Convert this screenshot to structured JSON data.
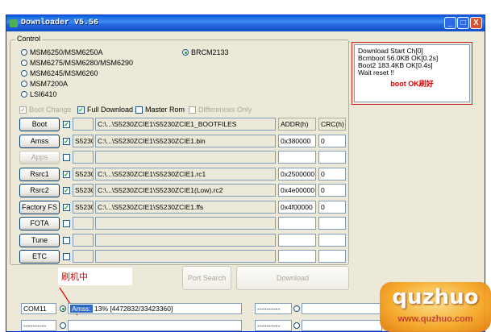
{
  "window": {
    "title": "Downloader V5.56",
    "controls": {
      "minimize": "_",
      "maximize": "□",
      "close": "X"
    }
  },
  "control_group": {
    "label": "Control",
    "chipsets": [
      {
        "label": "MSM6250/MSM6250A",
        "selected": false
      },
      {
        "label": "MSM6275/MSM6280/MSM6290",
        "selected": false
      },
      {
        "label": "MSM6245/MSM6260",
        "selected": false
      },
      {
        "label": "MSM7200A",
        "selected": false
      },
      {
        "label": "LSI6410",
        "selected": false
      },
      {
        "label": "BRCM2133",
        "selected": true
      }
    ]
  },
  "log": {
    "lines": [
      "Download Start Ch[0]",
      "Bcmboot 56.0KB OK[0.2s]",
      "Boot2 183.4KB OK[0.4s]",
      "Wait reset !!"
    ],
    "annotation": "boot OK刷好"
  },
  "options": {
    "boot_change": {
      "label": "Boot Change",
      "checked": true,
      "enabled": false
    },
    "full_download": {
      "label": "Full Download",
      "checked": true
    },
    "master_rom": {
      "label": "Master Rom",
      "checked": false
    },
    "differences_only": {
      "label": "Differences Only",
      "checked": false,
      "enabled": false
    }
  },
  "table": {
    "addr_header": "ADDR(h)",
    "crc_header": "CRC(h)",
    "rows": [
      {
        "button": "Boot",
        "enabled": true,
        "checked": true,
        "tag": "",
        "path": "C:\\...\\S5230ZCIE1\\S5230ZCIE1_BOOTFILES",
        "addr": "",
        "crc": ""
      },
      {
        "button": "Amss",
        "enabled": true,
        "checked": true,
        "tag": "S5230",
        "path": "C:\\...\\S5230ZCIE1\\S5230ZCIE1.bin",
        "addr": "0x380000",
        "crc": "0"
      },
      {
        "button": "Apps",
        "enabled": false,
        "checked": false,
        "tag": "",
        "path": "",
        "addr": "",
        "crc": ""
      },
      {
        "button": "Rsrc1",
        "enabled": true,
        "checked": true,
        "tag": "S5230",
        "path": "C:\\...\\S5230ZCIE1\\S5230ZCIE1.rc1",
        "addr": "0x2500000",
        "crc": "0"
      },
      {
        "button": "Rsrc2",
        "enabled": true,
        "checked": true,
        "tag": "S5230",
        "path": "C:\\...\\S5230ZCIE1\\S5230ZCIE1(Low).rc2",
        "addr": "0x4e00000",
        "crc": "0"
      },
      {
        "button": "Factory FS",
        "enabled": true,
        "checked": true,
        "tag": "S5230",
        "path": "C:\\...\\S5230ZCIE1\\S5230ZCIE1.ffs",
        "addr": "0x4f00000",
        "crc": "0"
      },
      {
        "button": "FOTA",
        "enabled": true,
        "checked": false,
        "tag": "",
        "path": "",
        "addr": "",
        "crc": ""
      },
      {
        "button": "Tune",
        "enabled": true,
        "checked": false,
        "tag": "",
        "path": "",
        "addr": "",
        "crc": ""
      },
      {
        "button": "ETC",
        "enabled": true,
        "checked": false,
        "tag": "",
        "path": "",
        "addr": "",
        "crc": ""
      }
    ]
  },
  "actions": {
    "port_search": "Port Search",
    "download": "Download"
  },
  "callout": "刷机中",
  "status": {
    "com_port": "COM11",
    "stage": "Amss:",
    "progress_text": "13% [4472832/33423360]",
    "placeholder_a": "----------",
    "placeholder_b": "----------"
  },
  "watermark": {
    "brand": "quzhuo",
    "url": "www.quzhuo.com"
  }
}
